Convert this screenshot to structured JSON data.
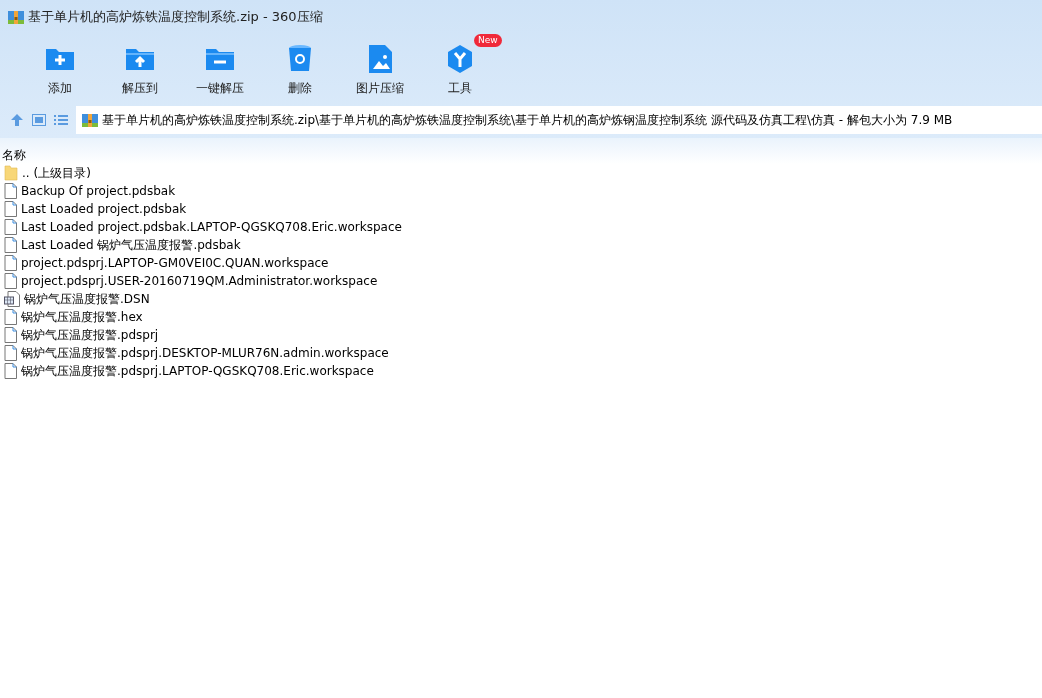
{
  "window": {
    "title": "基于单片机的高炉炼铁温度控制系统.zip - 360压缩"
  },
  "toolbar": [
    {
      "label": "添加",
      "kind": "add"
    },
    {
      "label": "解压到",
      "kind": "extract"
    },
    {
      "label": "一键解压",
      "kind": "oneclick"
    },
    {
      "label": "删除",
      "kind": "delete"
    },
    {
      "label": "图片压缩",
      "kind": "image"
    },
    {
      "label": "工具",
      "kind": "tools",
      "badge": "New"
    }
  ],
  "address_bar": {
    "path": "基于单片机的高炉炼铁温度控制系统.zip\\基于单片机的高炉炼铁温度控制系统\\基于单片机的高炉炼钢温度控制系统 源代码及仿真工程\\仿真 - 解包大小为 7.9 MB"
  },
  "table": {
    "columns": [
      "名称"
    ],
    "rows": [
      {
        "name": ".. (上级目录)",
        "kind": "folder"
      },
      {
        "name": "Backup Of project.pdsbak",
        "kind": "file"
      },
      {
        "name": "Last Loaded project.pdsbak",
        "kind": "file"
      },
      {
        "name": "Last Loaded project.pdsbak.LAPTOP-QGSKQ708.Eric.workspace",
        "kind": "file"
      },
      {
        "name": "Last Loaded 锅炉气压温度报警.pdsbak",
        "kind": "file"
      },
      {
        "name": "project.pdsprj.LAPTOP-GM0VEI0C.QUAN.workspace",
        "kind": "file"
      },
      {
        "name": "project.pdsprj.USER-20160719QM.Administrator.workspace",
        "kind": "file"
      },
      {
        "name": "锅炉气压温度报警.DSN",
        "kind": "design"
      },
      {
        "name": "锅炉气压温度报警.hex",
        "kind": "file"
      },
      {
        "name": "锅炉气压温度报警.pdsprj",
        "kind": "file"
      },
      {
        "name": "锅炉气压温度报警.pdsprj.DESKTOP-MLUR76N.admin.workspace",
        "kind": "file"
      },
      {
        "name": "锅炉气压温度报警.pdsprj.LAPTOP-QGSKQ708.Eric.workspace",
        "kind": "file"
      }
    ]
  }
}
